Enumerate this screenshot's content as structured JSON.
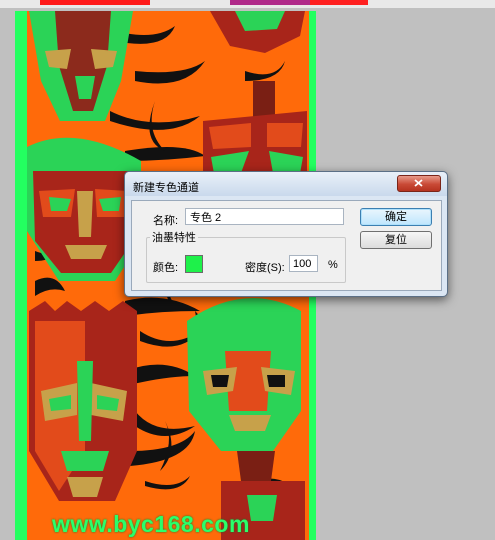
{
  "dialog": {
    "title": "新建专色通道",
    "name_label": "名称:",
    "name_value": "专色 2",
    "ink_group_label": "油墨特性",
    "color_label": "颜色:",
    "density_label": "密度(S):",
    "density_value": "100",
    "percent_label": "%",
    "ok_label": "确定",
    "reset_label": "复位",
    "swatch_color": "#1ef14a"
  },
  "canvas": {
    "watermark": "www.byc168.com"
  }
}
